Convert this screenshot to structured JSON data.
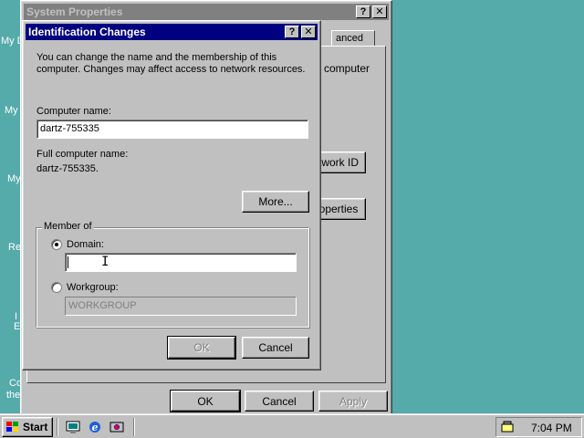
{
  "desktop": {
    "labels": [
      "My D",
      "My",
      "My",
      "Re",
      "I",
      "E",
      "Co",
      "the"
    ]
  },
  "system_properties": {
    "title": "System Properties",
    "help_button": "?",
    "close_button": "✕",
    "tab_advanced": "anced",
    "computer_label": "computer",
    "network_id_button": "twork ID",
    "properties_button": "operties",
    "ok_button": "OK",
    "cancel_button": "Cancel",
    "apply_button": "Apply"
  },
  "identification_changes": {
    "title": "Identification Changes",
    "help_button": "?",
    "close_button": "✕",
    "intro_text_line1": "You can change the name and the membership of this",
    "intro_text_line2": "computer. Changes may affect access to network resources.",
    "computer_name_label": "Computer name:",
    "computer_name_value": "dartz-755335",
    "full_name_label": "Full computer name:",
    "full_name_value": "dartz-755335.",
    "more_button": "More...",
    "member_of_label": "Member of",
    "domain_label": "Domain:",
    "domain_value": "",
    "domain_selected": true,
    "workgroup_label": "Workgroup:",
    "workgroup_value": "WORKGROUP",
    "ok_button": "OK",
    "cancel_button": "Cancel"
  },
  "taskbar": {
    "start_label": "Start",
    "quick_launch": [
      "desktop-icon",
      "ie-icon",
      "channels-icon"
    ],
    "clock": "7:04 PM"
  }
}
